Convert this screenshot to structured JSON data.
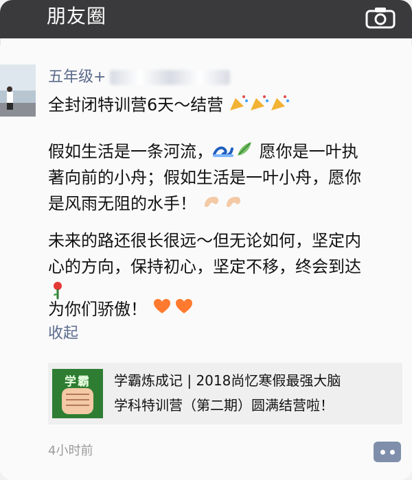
{
  "topbar": {
    "title": "朋友圈",
    "camera_icon": "camera-icon"
  },
  "post": {
    "author_visible": "五年级+",
    "headline": "全封闭特训营6天～结营",
    "paragraph1": {
      "line1_part1": "假如生活是一条河流，",
      "line1_part2": " 愿你是一叶执",
      "line2": "著向前的小舟；假如生活是一叶小舟，愿你",
      "line3": "是风雨无阻的水手！"
    },
    "paragraph2": {
      "line1": "未来的路还很长很远～但无论如何，坚定内",
      "line2": "心的方向，保持初心，坚定不移，终会到达",
      "line3": "为你们骄傲！"
    },
    "collapse_label": "收起",
    "link_card": {
      "thumb_text": "学霸",
      "title_line1": "学霸炼成记 | 2018尚忆寒假最强大脑",
      "title_line2": "学科特训营（第二期）圆满结营啦！"
    },
    "time": "4小时前",
    "more_icon": "comment-more-icon"
  },
  "colors": {
    "topbar_bg": "#3a3a3c",
    "link_blue": "#5b6b8c",
    "card_bg": "#efefef",
    "more_bg": "#7f8fab"
  }
}
